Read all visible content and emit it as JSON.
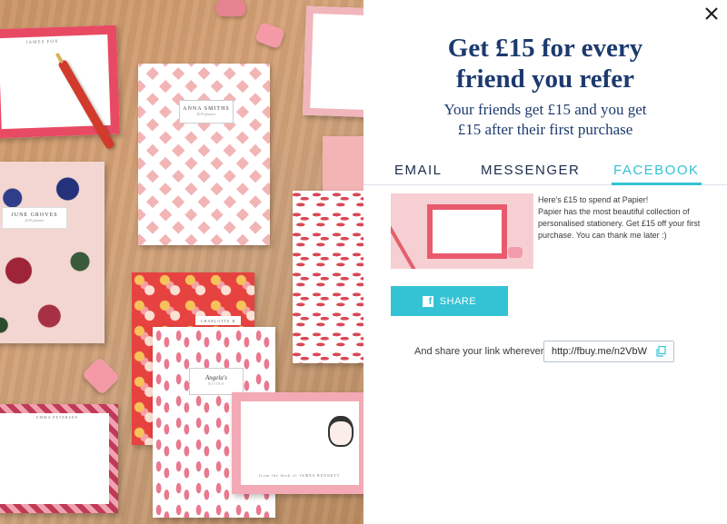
{
  "photo": {
    "card_top_left_name": "JAMES FOX",
    "floral_book_name": "JUNE GROVES",
    "floral_book_sub": "2019 planner",
    "chevron_book_name": "ANNA SMITHS",
    "chevron_book_sub": "2019 planner",
    "badge_book_name": "CHARLOTTE B",
    "flamingo_book_name": "Angela's",
    "flamingo_book_sub": "NOTES",
    "face_card_sig": "from the desk of JAMES BENNETT",
    "floral_card_sig": "EMMA PETERSEN"
  },
  "modal": {
    "close_icon": "close-icon",
    "headline": "Get £15 for every friend you refer",
    "subhead": "Your friends get £15 and you get £15 after their first purchase",
    "tabs": {
      "email": "EMAIL",
      "messenger": "MESSENGER",
      "facebook": "FACEBOOK",
      "active": "FACEBOOK"
    },
    "preview": {
      "line1": "Here's £15 to spend at Papier!",
      "line2": "Papier has the most beautiful collection of personalised stationery. Get £15 off your first purchase. You can thank me later :)"
    },
    "share_button": {
      "label": "SHARE",
      "icon": "facebook-icon"
    },
    "link": {
      "label": "And share your link wherever:",
      "url": "http://fbuy.me/n2VbW",
      "copy_icon": "copy-icon"
    }
  },
  "colors": {
    "accent": "#34c3d4",
    "headline": "#1c3a6e"
  }
}
